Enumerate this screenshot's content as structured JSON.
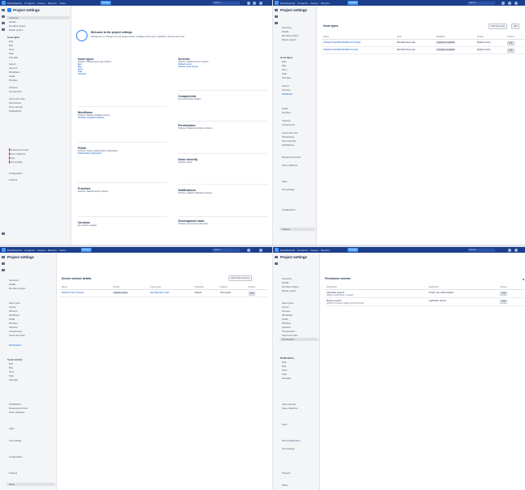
{
  "app": {
    "create_label": "Create",
    "search_placeholder": "Search",
    "nav": [
      "Dashboards",
      "Projects",
      "Issues",
      "Boards",
      "Tests",
      "Plans"
    ]
  },
  "project": {
    "name": "Project settings"
  },
  "sidebar": {
    "back": "Back to project",
    "items_a": [
      "Summary",
      "Details",
      "Re-index project",
      "Delete project",
      "Issue types",
      "Epic",
      "Bug",
      "Story",
      "Task",
      "Sub-task",
      "Layout",
      "Screens",
      "Workflows",
      "Fields",
      "Priorities",
      "Versions",
      "Components",
      "Users and roles",
      "Permissions",
      "Issue security",
      "Notifications",
      "Development tools",
      "Issue collectors",
      "Apps",
      "Test settings",
      "Configuration",
      "Projects",
      "Plans"
    ],
    "items_b": [
      "Summary",
      "Details",
      "Re-index project",
      "Delete project",
      "Issue types",
      "Epic",
      "Bug",
      "Story",
      "Task",
      "Sub-task",
      "Layout",
      "Screens",
      "Workflows",
      "Fields",
      "Priorities",
      "Versions",
      "Components",
      "Users and roles",
      "Permissions",
      "Notifications",
      "Issue security",
      "Issue collectors",
      "Apps",
      "Test Configuration",
      "Test settings",
      "Projects",
      "Plans"
    ]
  },
  "summary": {
    "welcome": "Welcome to the project settings",
    "intro": "Settings let you change how your project works. Configure issue types, workflows, screens and more.",
    "cards": [
      {
        "title": "Issue types",
        "lines": [
          "Scheme: Default issue type scheme",
          "Epic",
          "Bug",
          "Story",
          "Task",
          "Sub-task"
        ]
      },
      {
        "title": "Screens",
        "lines": [
          "Scheme: Default screen scheme",
          "Default screen",
          "Resolve issue screen"
        ]
      },
      {
        "title": "Workflows",
        "lines": [
          "Scheme: Default workflow scheme",
          "Software simplified workflow"
        ]
      },
      {
        "title": "Fields",
        "lines": [
          "Scheme: System default field configuration",
          "Default field configuration"
        ]
      },
      {
        "title": "Priorities",
        "lines": [
          "Scheme: Default priority scheme"
        ]
      },
      {
        "title": "Versions",
        "lines": [
          "No versions created"
        ]
      },
      {
        "title": "Components",
        "lines": [
          "No components created"
        ]
      },
      {
        "title": "Permissions",
        "lines": [
          "Scheme: Default permission scheme"
        ]
      },
      {
        "title": "Issue security",
        "lines": [
          "Scheme: None"
        ]
      },
      {
        "title": "Notifications",
        "lines": [
          "Scheme: Default notification scheme"
        ]
      },
      {
        "title": "Development tools",
        "lines": [
          "Connect your source code tools"
        ]
      }
    ]
  },
  "issue_types": {
    "heading": "Issue types",
    "columns": [
      "Name",
      "Type",
      "Workflow",
      "Screen",
      "Actions"
    ],
    "rows": [
      {
        "name": "Software Simplified Workflow for Project",
        "type": "Standard issue type",
        "workflow": "Software simplified",
        "screen": "Default screen",
        "action": "Edit"
      },
      {
        "name": "Software Simplified Workflow for Epic",
        "type": "Standard issue type",
        "workflow": "Software simplified",
        "screen": "Default screen",
        "action": "Edit"
      }
    ],
    "buttons": [
      "Add issue type",
      "Edit"
    ]
  },
  "screens": {
    "heading": "Screen scheme details",
    "button": "Add screen scheme",
    "columns": [
      "Name",
      "Screen",
      "Issue types",
      "Operation",
      "Projects",
      "Actions"
    ],
    "rows": [
      {
        "name": "Default Screen Scheme",
        "screen": "Default screen",
        "issue_types": "Epic Bug Story Task",
        "operation": "Default",
        "projects": "This project",
        "action": "Edit"
      }
    ]
  },
  "permissions": {
    "heading": "Permission scheme",
    "columns": [
      "Permission",
      "Granted to",
      "Actions"
    ],
    "rows": [
      {
        "permission": "Administer projects",
        "desc": "Ability to administer a project",
        "granted": "Project role: Administrators",
        "action": "Edit"
      },
      {
        "permission": "Browse projects",
        "desc": "Ability to browse projects and the issues",
        "granted": "Application access",
        "action": "Edit"
      }
    ]
  }
}
